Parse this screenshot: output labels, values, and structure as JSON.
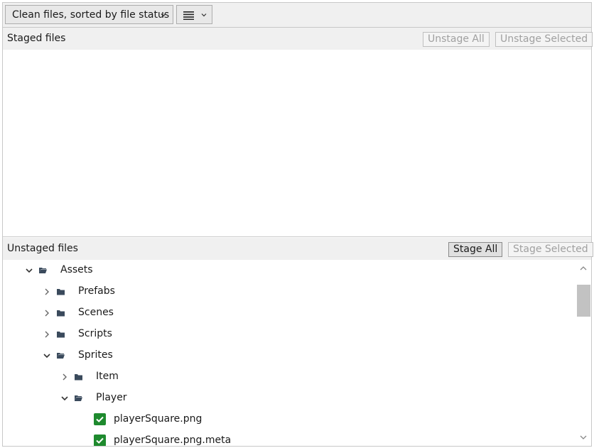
{
  "toolbar": {
    "view_mode_select": "Clean files, sorted by file status",
    "view_menu_icon": "list-lines-icon"
  },
  "staged": {
    "title": "Staged files",
    "unstage_all_label": "Unstage All",
    "unstage_selected_label": "Unstage Selected"
  },
  "unstaged": {
    "title": "Unstaged files",
    "stage_all_label": "Stage All",
    "stage_selected_label": "Stage Selected"
  },
  "tree": [
    {
      "label": "Assets",
      "depth": 0,
      "type": "folder",
      "expanded": true
    },
    {
      "label": "Prefabs",
      "depth": 1,
      "type": "folder",
      "expanded": false
    },
    {
      "label": "Scenes",
      "depth": 1,
      "type": "folder",
      "expanded": false
    },
    {
      "label": "Scripts",
      "depth": 1,
      "type": "folder",
      "expanded": false
    },
    {
      "label": "Sprites",
      "depth": 1,
      "type": "folder",
      "expanded": true
    },
    {
      "label": "Item",
      "depth": 2,
      "type": "folder",
      "expanded": false
    },
    {
      "label": "Player",
      "depth": 2,
      "type": "folder",
      "expanded": true
    },
    {
      "label": "playerSquare.png",
      "depth": 3,
      "type": "file",
      "checked": true
    },
    {
      "label": "playerSquare.png.meta",
      "depth": 3,
      "type": "file",
      "checked": true
    }
  ],
  "colors": {
    "checkbox": "#1e8a2e",
    "header_bg": "#f0f0f0",
    "folder_icon": "#3a4a5c"
  }
}
